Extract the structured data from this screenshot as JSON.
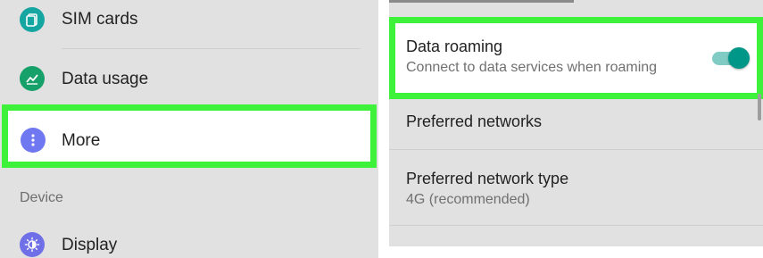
{
  "left_panel": {
    "items": [
      {
        "label": "SIM cards",
        "icon": "sim-card-icon",
        "icon_color": "#16a6a2"
      },
      {
        "label": "Data usage",
        "icon": "data-usage-icon",
        "icon_color": "#16a16a"
      },
      {
        "label": "More",
        "icon": "more-vertical-icon",
        "icon_color": "#6f78f0",
        "highlighted": true
      }
    ],
    "section_header": "Device",
    "device_items": [
      {
        "label": "Display",
        "icon": "display-brightness-icon",
        "icon_color": "#6f6fe8"
      }
    ]
  },
  "right_panel": {
    "data_roaming": {
      "title": "Data roaming",
      "subtitle": "Connect to data services when roaming",
      "toggle_on": true,
      "highlighted": true
    },
    "preferred_networks": {
      "title": "Preferred networks"
    },
    "preferred_network_type": {
      "title": "Preferred network type",
      "value": "4G (recommended)"
    }
  },
  "colors": {
    "highlight_border": "#3ef13a",
    "toggle_thumb": "#009688",
    "toggle_track": "#80cbc4",
    "panel_background": "#e1e1e1"
  }
}
